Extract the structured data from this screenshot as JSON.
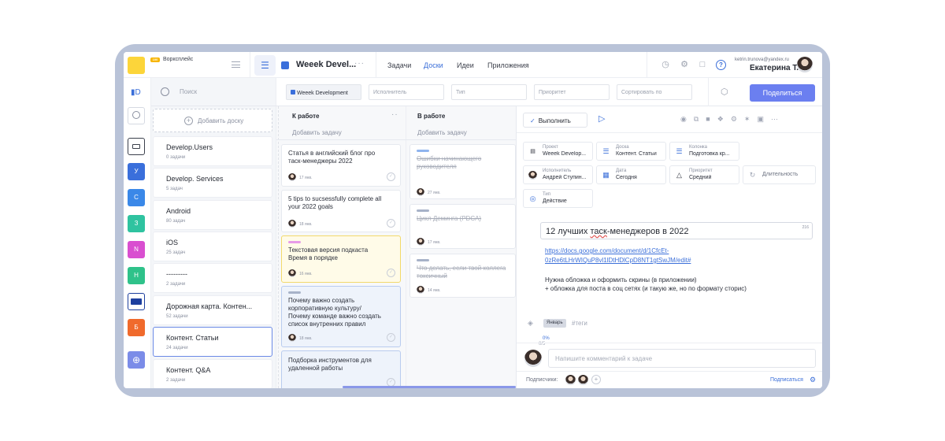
{
  "header": {
    "ws_badge": "100",
    "ws_label": "Ворксплейс",
    "project_name": "Weeek Devel...",
    "nav": [
      {
        "label": "Задачи",
        "active": false
      },
      {
        "label": "Доски",
        "active": true
      },
      {
        "label": "Идеи",
        "active": false
      },
      {
        "label": "Приложения",
        "active": false
      }
    ],
    "help": "?",
    "user_email": "ketrin.trunova@yandex.ru",
    "user_name": "Екатерина Т."
  },
  "rail": {
    "workspaces": [
      {
        "letter": "У",
        "color": "#3a6fdb"
      },
      {
        "letter": "С",
        "color": "#3a88e8"
      },
      {
        "letter": "З",
        "color": "#2fc3a0"
      },
      {
        "letter": "N",
        "color": "#d94fd0"
      },
      {
        "letter": "Н",
        "color": "#2fc28a"
      },
      {
        "letter": "Б",
        "color": "#f06a2c"
      }
    ]
  },
  "sidebar": {
    "search_placeholder": "Поиск",
    "add_board": "Добавить доску",
    "projects": [
      {
        "name": "Develop.Users",
        "count": "0 задачи"
      },
      {
        "name": "Develop. Services",
        "count": "5 задач"
      },
      {
        "name": "Android",
        "count": "80 задач"
      },
      {
        "name": "iOS",
        "count": "25 задач"
      },
      {
        "name": "---------",
        "count": "2 задачи"
      },
      {
        "name": "Дорожная карта. Контен...",
        "count": "52 задачи"
      },
      {
        "name": "Контент. Статьи",
        "count": "24 задачи"
      },
      {
        "name": "Контент. Q&A",
        "count": "2 задачи"
      }
    ]
  },
  "filters": {
    "project": "Weeek Development",
    "assignee": "Исполнитель",
    "type": "Тип",
    "priority": "Приоритет",
    "sort": "Сортировать по",
    "share": "Поделиться"
  },
  "board": {
    "col1": {
      "title": "К работе",
      "add": "Добавить задачу",
      "cards": [
        {
          "title1": "Статья в английский блог про",
          "title2": "таск-менеджеры 2022",
          "date": "17 янв."
        },
        {
          "title1": "5 tips to sucsessfully complete all",
          "title2": "your 2022 goals",
          "date": "18 янв."
        },
        {
          "title1": "Текстовая версия подкаста",
          "title2": "Время в порядке",
          "date": "16 янв."
        },
        {
          "title1": "Почему важно создать",
          "title2": "корпоративную культуру/",
          "title3": "Почему команде важно создать",
          "title4": "список внутренних правил",
          "date": "18 янв."
        },
        {
          "title1": "Подборка инструментов для",
          "title2": "удаленной работы"
        }
      ]
    },
    "col2": {
      "title": "В работе",
      "add": "Добавить задачу",
      "cards": [
        {
          "title1": "Ошибки начинающего",
          "title2": "руководителя",
          "date": "27 янв."
        },
        {
          "title1": "Цикл Деминга (PDCA)",
          "date": "17 янв."
        },
        {
          "title1": "Что делать, если твой коллега",
          "title2": "токсичный",
          "date": "14 янв."
        }
      ]
    }
  },
  "detail": {
    "done": "Выполнить",
    "props": {
      "project_label": "Проект",
      "project_value": "Weeek Develop...",
      "board_label": "Доска",
      "board_value": "Контент. Статьи",
      "column_label": "Колонка",
      "column_value": "Подготовка кр...",
      "assignee_label": "Исполнитель",
      "assignee_value": "Андрей Ступин...",
      "date_label": "Дата",
      "date_value": "Сегодня",
      "priority_label": "Приоритет",
      "priority_value": "Средний",
      "duration": "Длительность",
      "type_label": "Тип",
      "type_value": "Действие"
    },
    "title_a": "12 лучших ",
    "title_b": "таск",
    "title_c": "-менеджеров в 2022",
    "char_count": "216",
    "link1": "https://docs.google.com/document/d/1CfcEt-",
    "link2": "0zRe6tLHrWIQuP8vl1lDtHDlCpD8NT1gtSwJM/edit#",
    "desc1": "Нужна обложка и оформить скрины (в приложении)",
    "desc2": "+ обложка для поста в соц сетях (и такую же, но по формату сторис)",
    "tag": "Январь",
    "tags_placeholder": "#теги",
    "progress": "0%",
    "progress2": "0/5",
    "comment_placeholder": "Напишите комментарий к задаче",
    "subscribers_label": "Подписчики:",
    "subscribe": "Подписаться"
  }
}
